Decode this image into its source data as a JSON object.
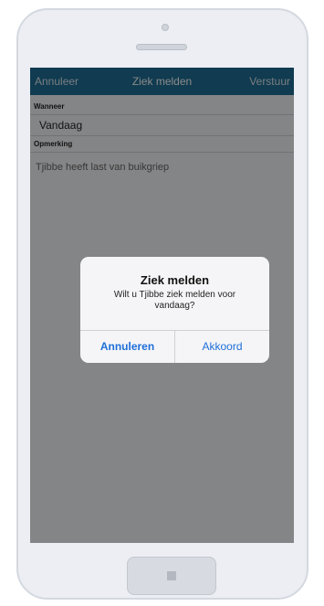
{
  "navbar": {
    "cancel_label": "Annuleer",
    "title": "Ziek melden",
    "submit_label": "Verstuur"
  },
  "form": {
    "when_label": "Wanneer",
    "when_value": "Vandaag",
    "remark_label": "Opmerking",
    "remark_value": "Tjibbe heeft last van buikgriep"
  },
  "dialog": {
    "title": "Ziek melden",
    "message": "Wilt u Tjibbe ziek melden voor vandaag?",
    "cancel_label": "Annuleren",
    "confirm_label": "Akkoord"
  },
  "colors": {
    "navbar": "#1f6d94",
    "dialog_button": "#1e6fd9"
  }
}
